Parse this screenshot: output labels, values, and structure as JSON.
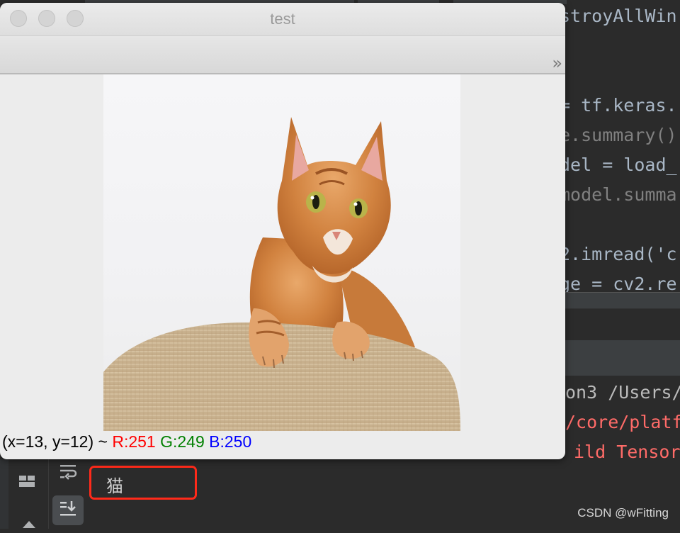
{
  "window": {
    "title": "test",
    "toolbar_overflow": "»"
  },
  "status": {
    "coords": "(x=13, y=12) ~",
    "r": "R:251",
    "g": "G:249",
    "b": "B:250"
  },
  "code_lines": [
    "stroyAllWin",
    "= tf.keras.",
    "e.summary()",
    "del = load_",
    "model.summa",
    "2.imread('c",
    "ge = cv2.re"
  ],
  "console_lines": [
    "on3 /Users/",
    "/core/platf",
    "ild TensorF"
  ],
  "console_output": "猫",
  "watermark": "CSDN @wFitting",
  "colors": {
    "highlight_box": "#ff2a1a",
    "status_r": "#ff0000",
    "status_g": "#008000",
    "status_b": "#0000ff"
  }
}
